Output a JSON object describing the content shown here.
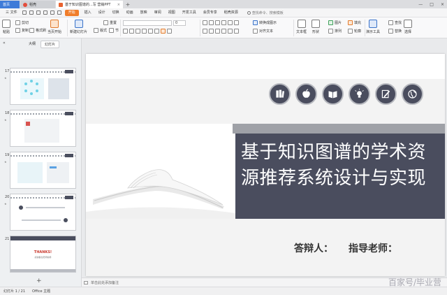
{
  "tabs": [
    {
      "label": "首页"
    },
    {
      "label": "稻壳"
    },
    {
      "label": "基于知识图谱的...写 营销PPT"
    }
  ],
  "menu": {
    "file_label": "三 文件",
    "start_label": "开始",
    "items": [
      "插入",
      "设计",
      "切换",
      "动画",
      "放映",
      "审阅",
      "视图",
      "开发工具",
      "会员专享",
      "稻壳资源"
    ],
    "search_placeholder": "查找命令、搜索模板"
  },
  "ribbon": {
    "paste": "粘贴",
    "cut": "剪切",
    "copy": "复制",
    "format_painter": "格式刷",
    "from_current": "当页开始",
    "new_slide": "新建幻灯片",
    "layout": "版式",
    "section": "节",
    "reset": "重置",
    "font_size": "0",
    "text_box": "文本框",
    "shape": "形状",
    "arrange": "排列",
    "picture": "图片",
    "fill": "填充",
    "outline": "轮廓",
    "find": "查找",
    "replace": "替换",
    "select": "选择",
    "presenter_tools": "演示工具",
    "convert_smartart": "转换成图示",
    "text_align": "对齐文本"
  },
  "left_pane": {
    "tab_outline": "大纲",
    "tab_slides": "幻灯片",
    "collapse": "«",
    "slides": [
      {
        "num": "17"
      },
      {
        "num": "18"
      },
      {
        "num": "19"
      },
      {
        "num": "20"
      },
      {
        "num": "21",
        "thanks": "THANKS!",
        "thanks_sub": "感谢各位老师指导"
      }
    ],
    "add": "+"
  },
  "slide": {
    "title_line1": "基于知识图谱的学术资",
    "title_line2": "源推荐系统设计与实现",
    "defender": "答辩人：",
    "advisor": "指导老师：",
    "icons": [
      "books-icon",
      "apple-icon",
      "open-book-icon",
      "lightbulb-icon",
      "pen-note-icon",
      "globe-icon"
    ]
  },
  "notes": {
    "placeholder": "单击此处添加备注"
  },
  "status": {
    "slide_counter": "幻灯片 1 / 21",
    "theme": "Office 主题"
  },
  "watermark": "百家号/毕业营",
  "colors": {
    "accent": "#f07d2a",
    "slate": "#4a4d5e",
    "tab_blue": "#3e7bd8"
  }
}
